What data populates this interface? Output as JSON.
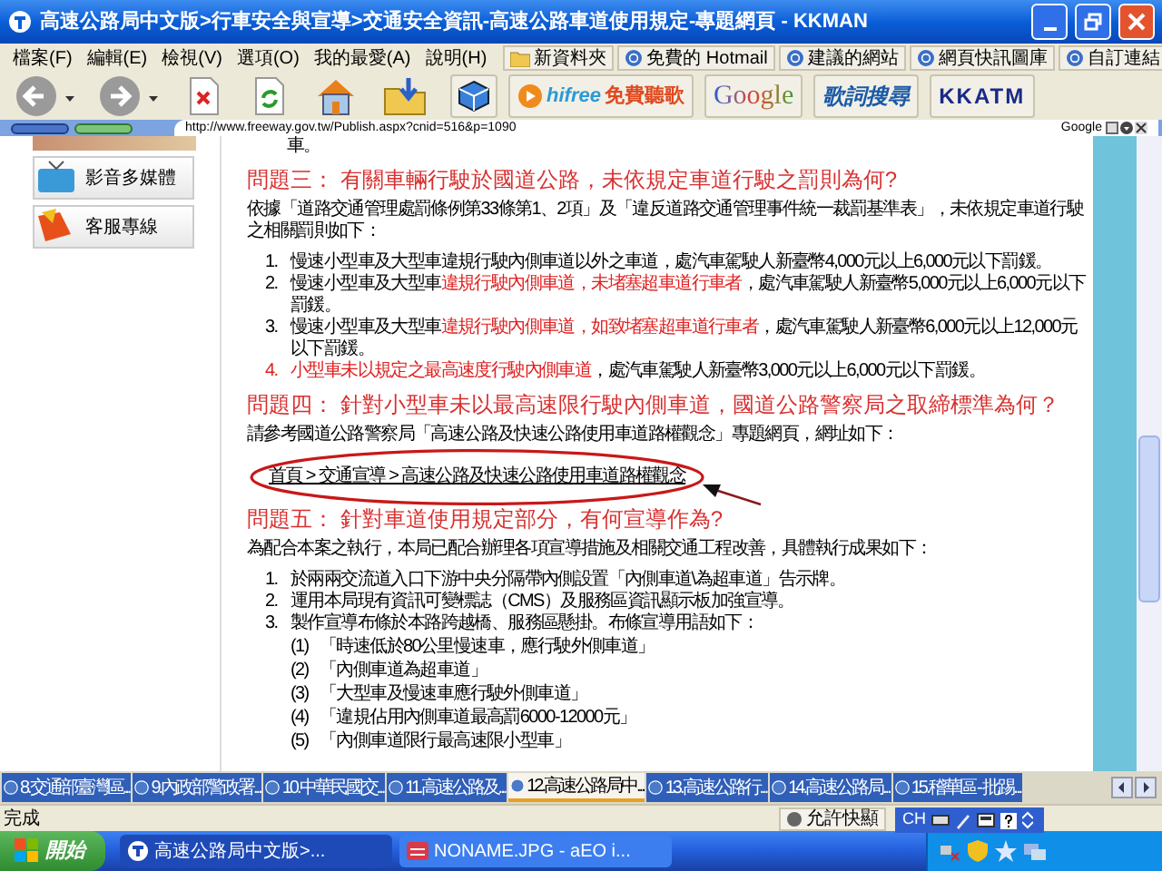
{
  "window": {
    "title": "高速公路局中文版>行車安全與宣導>交通安全資訊-高速公路車道使用規定-專題網頁 - KKMAN"
  },
  "menu": [
    "檔案(F)",
    "編輯(E)",
    "檢視(V)",
    "選項(O)",
    "我的最愛(A)",
    "說明(H)"
  ],
  "links_bar": [
    "新資料夾",
    "免費的 Hotmail",
    "建議的網站",
    "網頁快訊圖庫",
    "自訂連結"
  ],
  "toolbar": {
    "services": [
      {
        "kind": "hifree",
        "brand": "hifree",
        "label": "免費聽歌"
      },
      {
        "kind": "google",
        "label": "Google"
      },
      {
        "kind": "lyrics",
        "label": "歌詞搜尋"
      },
      {
        "kind": "kkatm",
        "label": "KKATM"
      }
    ]
  },
  "address_bar": {
    "url": "http://www.freeway.gov.tw/Publish.aspx?cnid=516&p=1090",
    "search_engine": "Google"
  },
  "sidebar": {
    "items": [
      "影音多媒體",
      "客服專線"
    ]
  },
  "content": {
    "lead_tail": "車。",
    "sections": [
      {
        "heading": "問題三： 有關車輛行駛於國道公路，未依規定車道行駛之罰則為何?",
        "paragraph": "依據「道路交通管理處罰條例第33條第1、2項」及「違反道路交通管理事件統一裁罰基準表」，未依規定車道行駛之相關罰則如下：",
        "items": [
          {
            "number": "1.",
            "segments": [
              {
                "text": "慢速小型車及大型車違規行駛內側車道以外之車道，處汽車駕駛人新臺幣4,000元以上6,000元以下罰鍰。",
                "highlight": false
              }
            ]
          },
          {
            "number": "2.",
            "segments": [
              {
                "text": "慢速小型車及大型車",
                "highlight": false
              },
              {
                "text": "違規行駛內側車道，未堵塞超車道行車者",
                "highlight": true
              },
              {
                "text": "，處汽車駕駛人新臺幣5,000元以上6,000元以下罰鍰。",
                "highlight": false
              }
            ]
          },
          {
            "number": "3.",
            "segments": [
              {
                "text": "慢速小型車及大型車",
                "highlight": false
              },
              {
                "text": "違規行駛內側車道，如致堵塞超車道行車者",
                "highlight": true
              },
              {
                "text": "，處汽車駕駛人新臺幣6,000元以上12,000元以下罰鍰。",
                "highlight": false
              }
            ]
          },
          {
            "number": "4.",
            "segments": [
              {
                "text": "小型車未以規定之最高速度行駛內側車道",
                "highlight": true
              },
              {
                "text": "，處汽車駕駛人新臺幣3,000元以上6,000元以下罰鍰。",
                "highlight": false
              }
            ]
          }
        ]
      },
      {
        "heading": "問題四： 針對小型車未以最高速限行駛內側車道，國道公路警察局之取締標準為何？",
        "paragraph": "請參考國道公路警察局「高速公路及快速公路使用車道路權觀念」專題網頁，網址如下：",
        "link": "首頁 > 交通宣導 > 高速公路及快速公路使用車道路權觀念"
      },
      {
        "heading": "問題五： 針對車道使用規定部分，有何宣導作為?",
        "paragraph": "為配合本案之執行，本局已配合辦理各項宣導措施及相關交通工程改善，具體執行成果如下：",
        "items": [
          {
            "number": "1.",
            "segments": [
              {
                "text": "於兩兩交流道入口下游中央分隔帶內側設置「內側車道\\為超車道」告示牌。",
                "highlight": false
              }
            ]
          },
          {
            "number": "2.",
            "segments": [
              {
                "text": "運用本局現有資訊可變標誌（CMS）及服務區資訊顯示板加強宣導。",
                "highlight": false
              }
            ]
          },
          {
            "number": "3.",
            "segments": [
              {
                "text": "製作宣導布條於本路跨越橋、服務區懸掛。布條宣導用語如下：",
                "highlight": false
              }
            ],
            "children": [
              {
                "number": "(1)",
                "text": "「時速低於80公里慢速車，應行駛外側車道」"
              },
              {
                "number": "(2)",
                "text": "「內側車道為超車道」"
              },
              {
                "number": "(3)",
                "text": "「大型車及慢速車應行駛外側車道」"
              },
              {
                "number": "(4)",
                "text": "「違規佔用內側車道最高罰6000-12000元」"
              },
              {
                "number": "(5)",
                "text": "「內側車道限行最高速限小型車」"
              }
            ]
          }
        ]
      }
    ]
  },
  "tabs": [
    {
      "label": "8.交通部臺灣區...",
      "selected": false
    },
    {
      "label": "9.內政部警政署...",
      "selected": false
    },
    {
      "label": "10.中華民國交...",
      "selected": false
    },
    {
      "label": "11.高速公路及...",
      "selected": false
    },
    {
      "label": "12.高速公路局中...",
      "selected": true
    },
    {
      "label": "13.高速公路行...",
      "selected": false
    },
    {
      "label": "14.高速公路局...",
      "selected": false
    },
    {
      "label": "15.稽華區 - 批踢...",
      "selected": false
    }
  ],
  "status_bar": {
    "text": "完成",
    "popup_blocker": "允許快顯",
    "language": "CH"
  },
  "taskbar": {
    "start": "開始",
    "tasks": [
      {
        "label": "高速公路局中文版>...",
        "selected": true
      },
      {
        "label": "NONAME.JPG - aEO i...",
        "selected": false
      }
    ]
  }
}
